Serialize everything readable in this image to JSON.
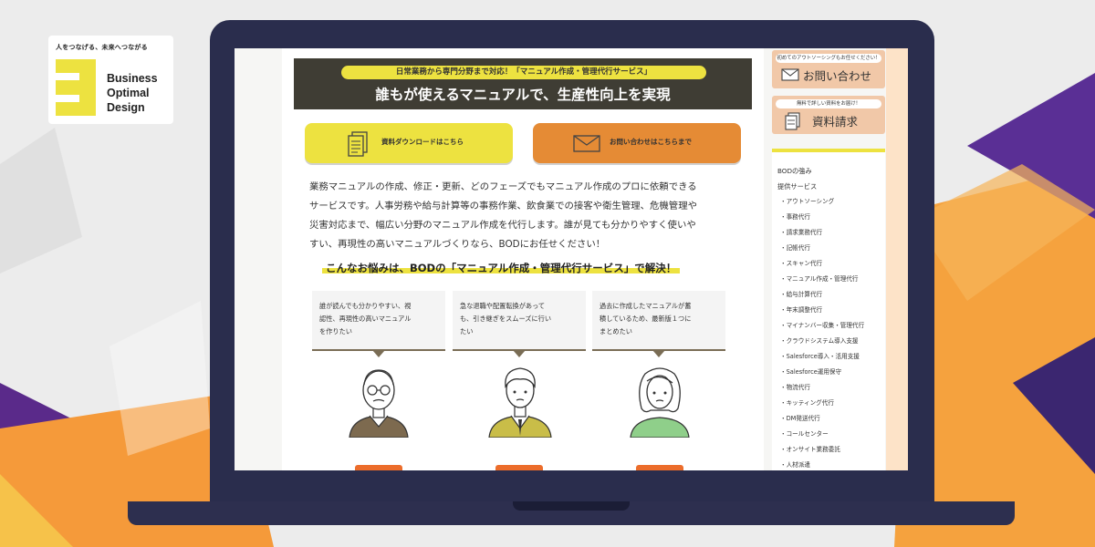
{
  "brand": {
    "tagline": "人をつなげる、未来へつながる",
    "name_lines": [
      "Business",
      "Optimal",
      "Design"
    ],
    "accent": "#ede240"
  },
  "hero": {
    "pill": "日常業務から専門分野まで対応！「マニュアル作成・管理代行サービス」",
    "title": "誰もが使えるマニュアルで、生産性向上を実現"
  },
  "cta": {
    "download_label": "資料ダウンロードはこちら",
    "contact_label": "お問い合わせはこちらまで",
    "download_icon": "document-icon",
    "contact_icon": "mail-icon"
  },
  "intro": {
    "lines": [
      "業務マニュアルの作成、修正・更新、どのフェーズでもマニュアル作成のプロに依頼できる",
      "サービスです。人事労務や給与計算等の事務作業、飲食業での接客や衛生管理、危機管理や",
      "災害対応まで、幅広い分野のマニュアル作成を代行します。誰が見ても分かりやすく使いや",
      "すい、再現性の高いマニュアルづくりなら、BODにお任せください！"
    ]
  },
  "headline": "こんなお悩みは、BODの「マニュアル作成・管理代行サービス」で解決！",
  "worries": [
    {
      "lines": [
        "誰が読んでも分かりやすい、視",
        "認性、再現性の高いマニュアル",
        "を作りたい"
      ]
    },
    {
      "lines": [
        "急な退職や配置転換があって",
        "も、引き継ぎをスムーズに行い",
        "たい"
      ]
    },
    {
      "lines": [
        "過去に作成したマニュアルが蓄",
        "積しているため、最新版１つに",
        "まとめたい"
      ]
    }
  ],
  "sidebar": {
    "contact_top": "初めてのアウトソーシングもお任せください！",
    "contact_label": "お問い合わせ",
    "contact_icon": "mail-icon",
    "docs_top": "無料で詳しい資料をお届け！",
    "docs_label": "資料請求",
    "docs_icon": "document-icon",
    "menu_head_1": "BODの強み",
    "menu_head_2": "提供サービス",
    "menu_items": [
      "・アウトソーシング",
      "・事務代行",
      "・請求業務代行",
      "・記帳代行",
      "・スキャン代行",
      "・マニュアル作成・管理代行",
      "・給与計算代行",
      "・年末調整代行",
      "・マイナンバー収集・管理代行",
      "・クラウドシステム導入支援",
      "・Salesforce導入・活用支援",
      "・Salesforce運用保守",
      "・物流代行",
      "・キッティング代行",
      "・DM発送代行",
      "・コールセンター",
      "・オンサイト業務委託",
      "・人材派遣"
    ]
  },
  "colors": {
    "hero_bg": "#3f3d34",
    "yellow": "#ede240",
    "orange": "#e58b35",
    "laptop": "#2a2d4d"
  }
}
